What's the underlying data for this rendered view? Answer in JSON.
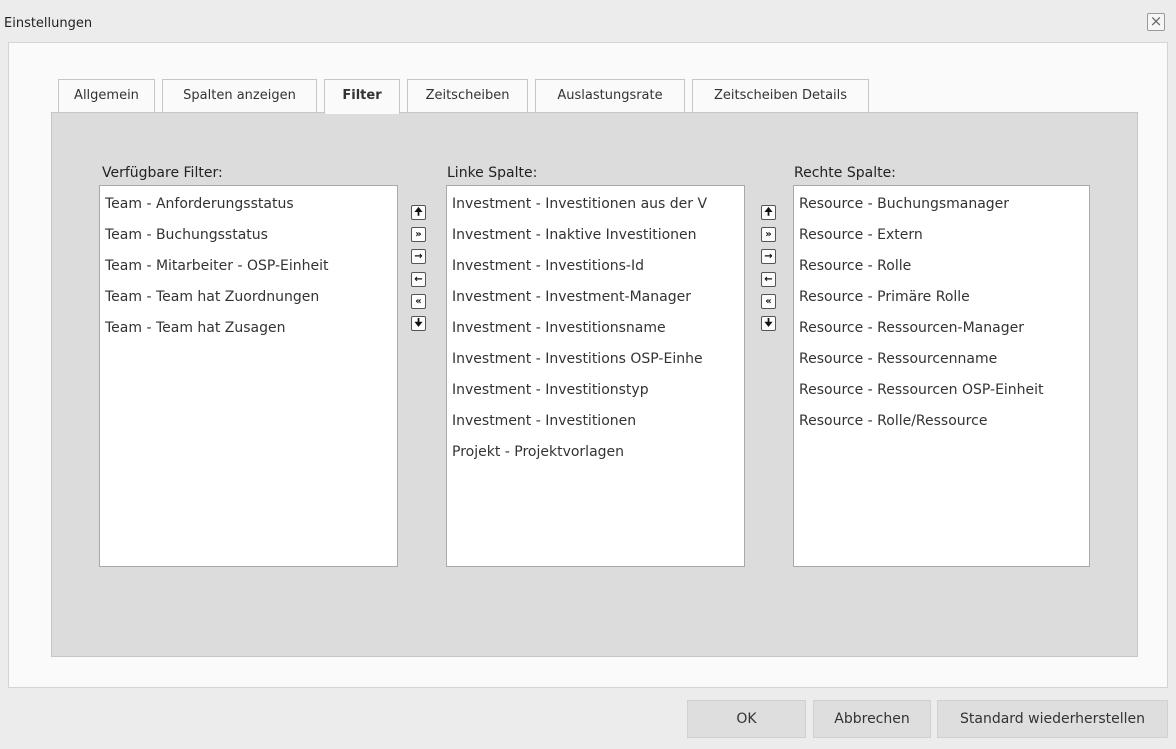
{
  "window": {
    "title": "Einstellungen",
    "close_glyph": "×"
  },
  "tabs": [
    {
      "label": "Allgemein",
      "active": false
    },
    {
      "label": "Spalten anzeigen",
      "active": false
    },
    {
      "label": "Filter",
      "active": true
    },
    {
      "label": "Zeitscheiben",
      "active": false
    },
    {
      "label": "Auslastungsrate",
      "active": false
    },
    {
      "label": "Zeitscheiben Details",
      "active": false
    }
  ],
  "columns": {
    "available": {
      "label": "Verfügbare Filter:",
      "items": [
        "Team - Anforderungsstatus",
        "Team - Buchungsstatus",
        "Team - Mitarbeiter - OSP-Einheit",
        "Team - Team hat Zuordnungen",
        "Team - Team hat Zusagen"
      ]
    },
    "left": {
      "label": "Linke Spalte:",
      "items": [
        "Investment - Investitionen aus der V",
        "Investment - Inaktive Investitionen",
        "Investment - Investitions-Id",
        "Investment - Investment-Manager",
        "Investment - Investitionsname",
        "Investment - Investitions OSP-Einhe",
        "Investment - Investitionstyp",
        "Investment - Investitionen",
        "Projekt - Projektvorlagen"
      ]
    },
    "right": {
      "label": "Rechte Spalte:",
      "items": [
        "Resource - Buchungsmanager",
        "Resource - Extern",
        "Resource - Rolle",
        "Resource - Primäre Rolle",
        "Resource - Ressourcen-Manager",
        "Resource - Ressourcenname",
        "Resource - Ressourcen OSP-Einheit",
        "Resource - Rolle/Ressource"
      ]
    }
  },
  "move_buttons": {
    "up": "🠉",
    "add_all": "»",
    "add": "→",
    "remove": "←",
    "remove_all": "«",
    "down": "🠋"
  },
  "footer": {
    "ok": "OK",
    "cancel": "Abbrechen",
    "reset": "Standard wiederherstellen"
  }
}
